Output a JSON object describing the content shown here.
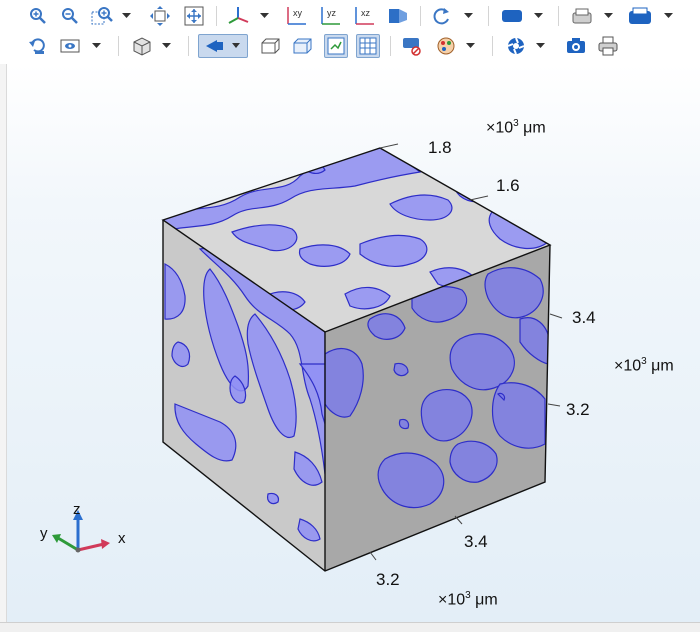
{
  "toolbar": {
    "row1": [
      "zoom-in-icon",
      "zoom-out-icon",
      "zoom-box-icon",
      "zoom-extents-icon",
      "zoom-fit-icon",
      "view-axes-icon",
      "xy-plane-icon",
      "yz-plane-icon",
      "xz-plane-icon",
      "go-to-view-icon",
      "rotate-icon",
      "selection-icon",
      "scene-light-icon",
      "image-icon"
    ],
    "row2": [
      "reset-view-icon",
      "camera-icon",
      "box-icon",
      "perspective-icon",
      "wireframe-icon",
      "transparency-icon",
      "select-geometry-icon",
      "grid-icon",
      "hide-icon",
      "color-icon",
      "render-icon",
      "snapshot-icon",
      "print-icon"
    ],
    "plane_labels": {
      "xy": "xy",
      "yz": "yz",
      "xz": "xz"
    }
  },
  "axes": {
    "top_unit_prefix": "×10",
    "top_unit_exp": "3",
    "top_unit_suffix": " μm",
    "top_ticks": [
      "1.8",
      "1.6"
    ],
    "right_unit_prefix": "×10",
    "right_unit_exp": "3",
    "right_unit_suffix": " μm",
    "right_ticks": [
      "3.4",
      "3.2"
    ],
    "bottom_unit_prefix": "×10",
    "bottom_unit_exp": "3",
    "bottom_unit_suffix": " μm",
    "bottom_ticks": [
      "3.4",
      "3.2"
    ]
  },
  "triad": {
    "x": "x",
    "y": "y",
    "z": "z"
  },
  "colors": {
    "cube_top": "#d6d6d6",
    "cube_left": "#c8c8c8",
    "cube_right": "#a9a9a9",
    "pore_fill": "#8f8ff5",
    "pore_edge": "#2e2ec8",
    "accent": "#1a5fb4"
  }
}
